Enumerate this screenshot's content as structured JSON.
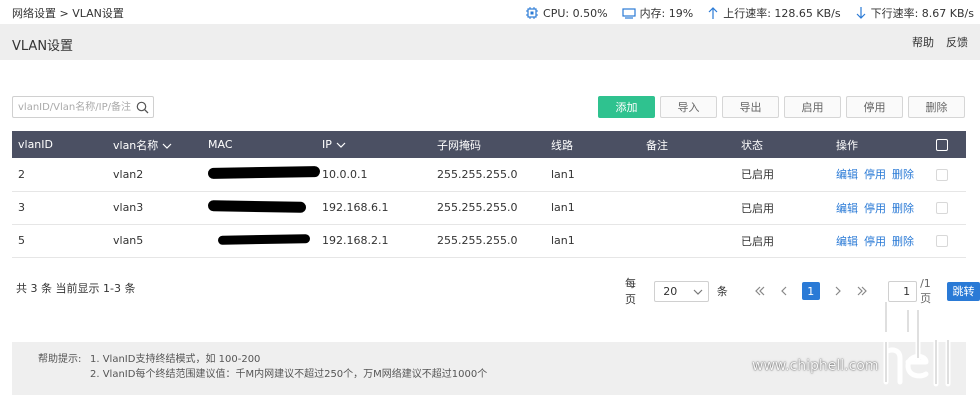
{
  "topbar": {
    "breadcrumb": "网络设置 > VLAN设置",
    "cpu": "CPU: 0.50%",
    "memory": "内存: 19%",
    "upload": "上行速率: 128.65 KB/s",
    "download": "下行速率: 8.67 KB/s"
  },
  "header": {
    "title": "VLAN设置",
    "help": "帮助",
    "feedback": "反馈"
  },
  "search": {
    "placeholder": "vlanID/Vlan名称/IP/备注"
  },
  "toolbar": {
    "add": "添加",
    "import": "导入",
    "export": "导出",
    "enable": "启用",
    "disable": "停用",
    "delete": "删除"
  },
  "table": {
    "headers": {
      "vlanid": "vlanID",
      "name": "vlan名称",
      "mac": "MAC",
      "ip": "IP",
      "mask": "子网掩码",
      "line": "线路",
      "note": "备注",
      "status": "状态",
      "ops": "操作"
    },
    "rows": [
      {
        "vlanid": "2",
        "name": "vlan2",
        "ip": "10.0.0.1",
        "mask": "255.255.255.0",
        "line": "lan1",
        "note": "",
        "status": "已启用",
        "edit": "编辑",
        "disable": "停用",
        "delete": "删除"
      },
      {
        "vlanid": "3",
        "name": "vlan3",
        "ip": "192.168.6.1",
        "mask": "255.255.255.0",
        "line": "lan1",
        "note": "",
        "status": "已启用",
        "edit": "编辑",
        "disable": "停用",
        "delete": "删除"
      },
      {
        "vlanid": "5",
        "name": "vlan5",
        "ip": "192.168.2.1",
        "mask": "255.255.255.0",
        "line": "lan1",
        "note": "",
        "status": "已启用",
        "edit": "编辑",
        "disable": "停用",
        "delete": "删除"
      }
    ]
  },
  "summary": "共 3 条 当前显示 1-3 条",
  "pagination": {
    "per_page_label": "每页",
    "per_page": "20",
    "unit": "条",
    "current": "1",
    "page_input": "1",
    "total": "/1页",
    "jump": "跳转"
  },
  "tips": {
    "label": "帮助提示:",
    "line1": "1. VlanID支持终结模式，如 100-200",
    "line2": "2. VlanID每个终结范围建议值：千M内网建议不超过250个，万M网络建议不超过1000个"
  },
  "watermark": {
    "url": "www.chiphell.com"
  },
  "colors": {
    "primary": "#2fc28f",
    "link": "#2a7ad6",
    "table_header": "#4b5063"
  }
}
